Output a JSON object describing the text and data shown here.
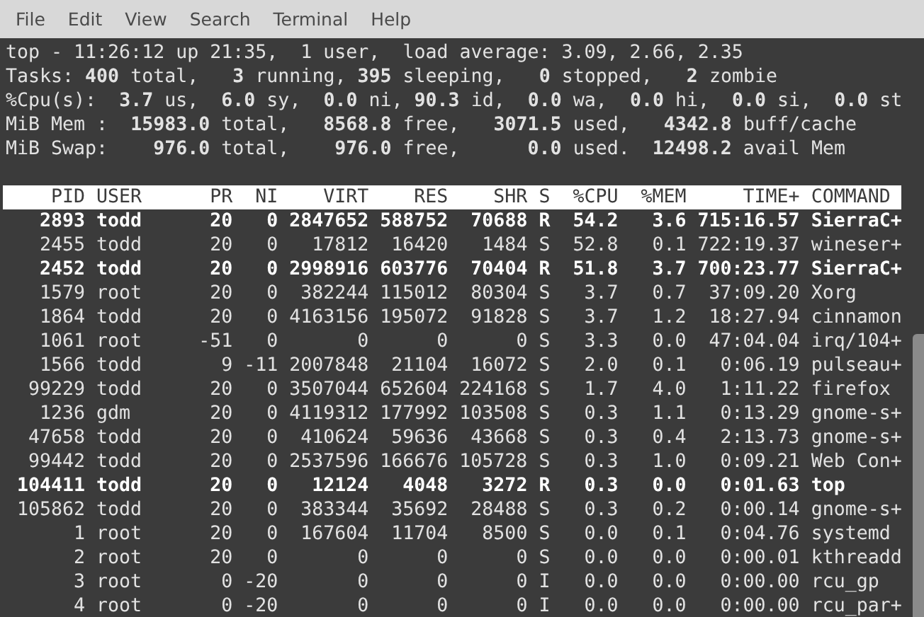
{
  "menu": [
    "File",
    "Edit",
    "View",
    "Search",
    "Terminal",
    "Help"
  ],
  "summary": [
    "top - 11:26:12 up 21:35,  1 user,  load average: 3.09, 2.66, 2.35",
    "Tasks: **400** total,   **3** running, **395** sleeping,   **0** stopped,   **2** zombie",
    "%Cpu(s):  **3.7** us,  **6.0** sy,  **0.0** ni, **90.3** id,  **0.0** wa,  **0.0** hi,  **0.0** si,  **0.0** st",
    "MiB Mem :  **15983.0** total,   **8568.8** free,   **3071.5** used,   **4342.8** buff/cache",
    "MiB Swap:    **976.0** total,    **976.0** free,      **0.0** used.  **12498.2** avail Mem"
  ],
  "table": {
    "columns": [
      "PID",
      "USER",
      "PR",
      "NI",
      "VIRT",
      "RES",
      "SHR",
      "S",
      "%CPU",
      "%MEM",
      "TIME+",
      "COMMAND"
    ],
    "rows": [
      {
        "bold": true,
        "cells": [
          "2893",
          "todd",
          "20",
          "0",
          "2847652",
          "588752",
          "70688",
          "R",
          "54.2",
          "3.6",
          "715:16.57",
          "SierraC+"
        ]
      },
      {
        "bold": false,
        "cells": [
          "2455",
          "todd",
          "20",
          "0",
          "17812",
          "16420",
          "1484",
          "S",
          "52.8",
          "0.1",
          "722:19.37",
          "wineser+"
        ]
      },
      {
        "bold": true,
        "cells": [
          "2452",
          "todd",
          "20",
          "0",
          "2998916",
          "603776",
          "70404",
          "R",
          "51.8",
          "3.7",
          "700:23.77",
          "SierraC+"
        ]
      },
      {
        "bold": false,
        "cells": [
          "1579",
          "root",
          "20",
          "0",
          "382244",
          "115012",
          "80304",
          "S",
          "3.7",
          "0.7",
          "37:09.20",
          "Xorg"
        ]
      },
      {
        "bold": false,
        "cells": [
          "1864",
          "todd",
          "20",
          "0",
          "4163156",
          "195072",
          "91828",
          "S",
          "3.7",
          "1.2",
          "18:27.94",
          "cinnamon"
        ]
      },
      {
        "bold": false,
        "cells": [
          "1061",
          "root",
          "-51",
          "0",
          "0",
          "0",
          "0",
          "S",
          "3.3",
          "0.0",
          "47:04.04",
          "irq/104+"
        ]
      },
      {
        "bold": false,
        "cells": [
          "1566",
          "todd",
          "9",
          "-11",
          "2007848",
          "21104",
          "16072",
          "S",
          "2.0",
          "0.1",
          "0:06.19",
          "pulseau+"
        ]
      },
      {
        "bold": false,
        "cells": [
          "99229",
          "todd",
          "20",
          "0",
          "3507044",
          "652604",
          "224168",
          "S",
          "1.7",
          "4.0",
          "1:11.22",
          "firefox"
        ]
      },
      {
        "bold": false,
        "cells": [
          "1236",
          "gdm",
          "20",
          "0",
          "4119312",
          "177992",
          "103508",
          "S",
          "0.3",
          "1.1",
          "0:13.29",
          "gnome-s+"
        ]
      },
      {
        "bold": false,
        "cells": [
          "47658",
          "todd",
          "20",
          "0",
          "410624",
          "59636",
          "43668",
          "S",
          "0.3",
          "0.4",
          "2:13.73",
          "gnome-s+"
        ]
      },
      {
        "bold": false,
        "cells": [
          "99442",
          "todd",
          "20",
          "0",
          "2537596",
          "166676",
          "105728",
          "S",
          "0.3",
          "1.0",
          "0:09.21",
          "Web Con+"
        ]
      },
      {
        "bold": true,
        "cells": [
          "104411",
          "todd",
          "20",
          "0",
          "12124",
          "4048",
          "3272",
          "R",
          "0.3",
          "0.0",
          "0:01.63",
          "top"
        ]
      },
      {
        "bold": false,
        "cells": [
          "105862",
          "todd",
          "20",
          "0",
          "383344",
          "35692",
          "28488",
          "S",
          "0.3",
          "0.2",
          "0:00.14",
          "gnome-s+"
        ]
      },
      {
        "bold": false,
        "cells": [
          "1",
          "root",
          "20",
          "0",
          "167604",
          "11704",
          "8500",
          "S",
          "0.0",
          "0.1",
          "0:04.76",
          "systemd"
        ]
      },
      {
        "bold": false,
        "cells": [
          "2",
          "root",
          "20",
          "0",
          "0",
          "0",
          "0",
          "S",
          "0.0",
          "0.0",
          "0:00.01",
          "kthreadd"
        ]
      },
      {
        "bold": false,
        "cells": [
          "3",
          "root",
          "0",
          "-20",
          "0",
          "0",
          "0",
          "I",
          "0.0",
          "0.0",
          "0:00.00",
          "rcu_gp"
        ]
      },
      {
        "bold": false,
        "cells": [
          "4",
          "root",
          "0",
          "-20",
          "0",
          "0",
          "0",
          "I",
          "0.0",
          "0.0",
          "0:00.00",
          "rcu_par+"
        ]
      }
    ]
  }
}
